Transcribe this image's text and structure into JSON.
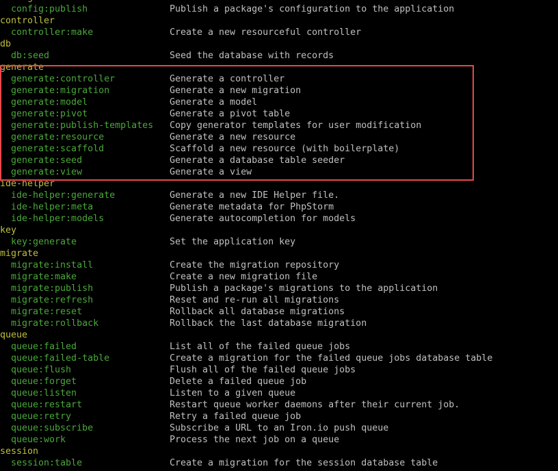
{
  "terminal": {
    "lines": [
      {
        "kind": "ns",
        "text": "config"
      },
      {
        "kind": "cmd",
        "cmd": "config:publish",
        "desc": "Publish a package's configuration to the application"
      },
      {
        "kind": "ns",
        "text": "controller"
      },
      {
        "kind": "cmd",
        "cmd": "controller:make",
        "desc": "Create a new resourceful controller"
      },
      {
        "kind": "ns",
        "text": "db"
      },
      {
        "kind": "cmd",
        "cmd": "db:seed",
        "desc": "Seed the database with records"
      },
      {
        "kind": "ns",
        "text": "generate"
      },
      {
        "kind": "cmd",
        "cmd": "generate:controller",
        "desc": "Generate a controller"
      },
      {
        "kind": "cmd",
        "cmd": "generate:migration",
        "desc": "Generate a new migration"
      },
      {
        "kind": "cmd",
        "cmd": "generate:model",
        "desc": "Generate a model"
      },
      {
        "kind": "cmd",
        "cmd": "generate:pivot",
        "desc": "Generate a pivot table"
      },
      {
        "kind": "cmd",
        "cmd": "generate:publish-templates",
        "desc": "Copy generator templates for user modification"
      },
      {
        "kind": "cmd",
        "cmd": "generate:resource",
        "desc": "Generate a new resource"
      },
      {
        "kind": "cmd",
        "cmd": "generate:scaffold",
        "desc": "Scaffold a new resource (with boilerplate)"
      },
      {
        "kind": "cmd",
        "cmd": "generate:seed",
        "desc": "Generate a database table seeder"
      },
      {
        "kind": "cmd",
        "cmd": "generate:view",
        "desc": "Generate a view"
      },
      {
        "kind": "ns",
        "text": "ide-helper"
      },
      {
        "kind": "cmd",
        "cmd": "ide-helper:generate",
        "desc": "Generate a new IDE Helper file."
      },
      {
        "kind": "cmd",
        "cmd": "ide-helper:meta",
        "desc": "Generate metadata for PhpStorm"
      },
      {
        "kind": "cmd",
        "cmd": "ide-helper:models",
        "desc": "Generate autocompletion for models"
      },
      {
        "kind": "ns",
        "text": "key"
      },
      {
        "kind": "cmd",
        "cmd": "key:generate",
        "desc": "Set the application key"
      },
      {
        "kind": "ns",
        "text": "migrate"
      },
      {
        "kind": "cmd",
        "cmd": "migrate:install",
        "desc": "Create the migration repository"
      },
      {
        "kind": "cmd",
        "cmd": "migrate:make",
        "desc": "Create a new migration file"
      },
      {
        "kind": "cmd",
        "cmd": "migrate:publish",
        "desc": "Publish a package's migrations to the application"
      },
      {
        "kind": "cmd",
        "cmd": "migrate:refresh",
        "desc": "Reset and re-run all migrations"
      },
      {
        "kind": "cmd",
        "cmd": "migrate:reset",
        "desc": "Rollback all database migrations"
      },
      {
        "kind": "cmd",
        "cmd": "migrate:rollback",
        "desc": "Rollback the last database migration"
      },
      {
        "kind": "ns",
        "text": "queue"
      },
      {
        "kind": "cmd",
        "cmd": "queue:failed",
        "desc": "List all of the failed queue jobs"
      },
      {
        "kind": "cmd",
        "cmd": "queue:failed-table",
        "desc": "Create a migration for the failed queue jobs database table"
      },
      {
        "kind": "cmd",
        "cmd": "queue:flush",
        "desc": "Flush all of the failed queue jobs"
      },
      {
        "kind": "cmd",
        "cmd": "queue:forget",
        "desc": "Delete a failed queue job"
      },
      {
        "kind": "cmd",
        "cmd": "queue:listen",
        "desc": "Listen to a given queue"
      },
      {
        "kind": "cmd",
        "cmd": "queue:restart",
        "desc": "Restart queue worker daemons after their current job."
      },
      {
        "kind": "cmd",
        "cmd": "queue:retry",
        "desc": "Retry a failed queue job"
      },
      {
        "kind": "cmd",
        "cmd": "queue:subscribe",
        "desc": "Subscribe a URL to an Iron.io push queue"
      },
      {
        "kind": "cmd",
        "cmd": "queue:work",
        "desc": "Process the next job on a queue"
      },
      {
        "kind": "ns",
        "text": "session"
      },
      {
        "kind": "cmd",
        "cmd": "session:table",
        "desc": "Create a migration for the session database table"
      }
    ]
  },
  "colors": {
    "background": "#000000",
    "namespace": "#bfbf3f",
    "command": "#4aa83a",
    "description": "#c0c0c0",
    "highlight": "#e8484a"
  }
}
